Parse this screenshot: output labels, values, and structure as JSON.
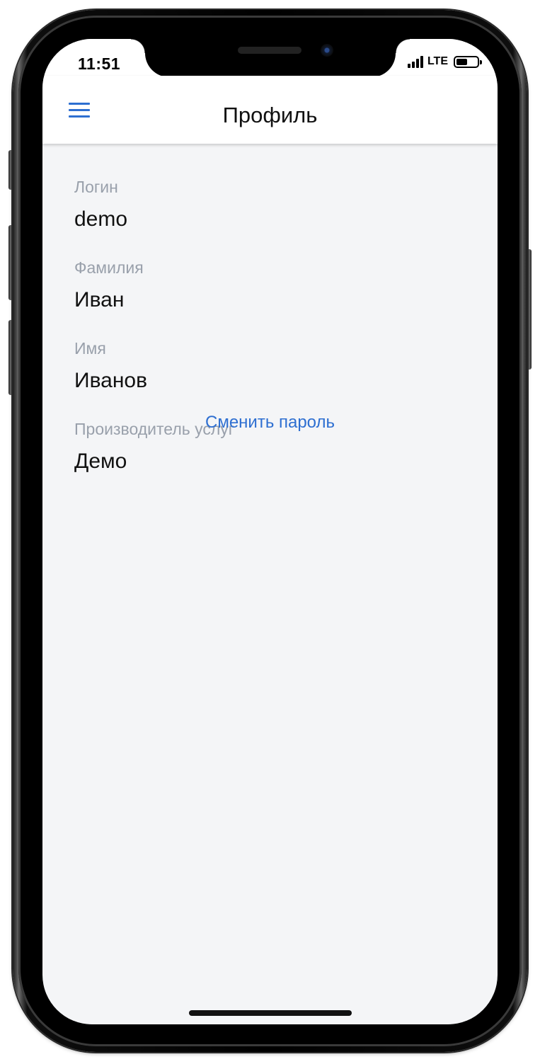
{
  "status_bar": {
    "time": "11:51",
    "network": "LTE",
    "signal_icon": "cellular-signal-icon",
    "battery_icon": "battery-icon",
    "battery_level": 0.55
  },
  "header": {
    "title": "Профиль",
    "menu_icon": "hamburger-menu-icon",
    "accent_color": "#2e6fd1"
  },
  "profile": {
    "fields": [
      {
        "label": "Логин",
        "value": "demo"
      },
      {
        "label": "Фамилия",
        "value": "Иван"
      },
      {
        "label": "Имя",
        "value": "Иванов"
      },
      {
        "label": "Производитель услуг",
        "value": "Демо"
      }
    ],
    "change_password_label": "Сменить пароль"
  },
  "colors": {
    "background": "#f4f5f7",
    "label": "#99a0ab",
    "value": "#111111",
    "link": "#2e6fd1"
  }
}
